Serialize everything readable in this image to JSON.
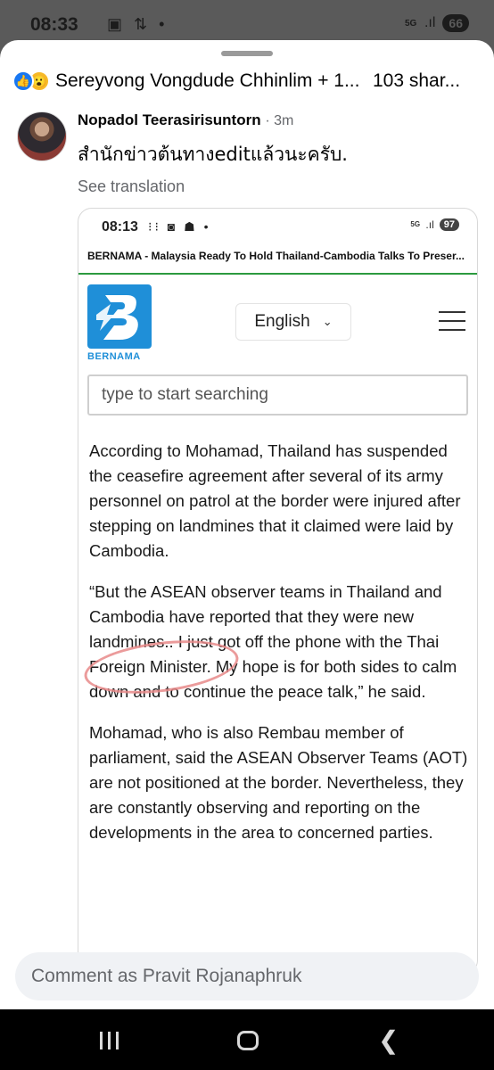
{
  "status_bar": {
    "time": "08:33",
    "network": "5G",
    "battery": "66"
  },
  "reactions": {
    "names": "Sereyvong Vongdude Chhinlim + 1...",
    "shares": "103 shar..."
  },
  "comment": {
    "author": "Nopadol Teerasirisuntorn",
    "time": "· 3m",
    "text": "สำนักข่าวต้นทางeditแล้วนะครับ.",
    "see_translation": "See translation"
  },
  "embedded_screenshot": {
    "status": {
      "time": "08:13",
      "network": "5G",
      "battery": "97"
    },
    "page_title": "BERNAMA - Malaysia Ready To Hold Thailand-Cambodia Talks To Preser...",
    "logo_text": "BERNAMA",
    "language": "English",
    "search_placeholder": "type to start searching",
    "paragraphs": [
      "According to Mohamad, Thailand has suspended the ceasefire agreement after several of its army personnel on patrol at the border were injured after stepping on landmines that it claimed were laid by Cambodia.",
      "“But the ASEAN observer teams in Thailand and Cambodia have reported that they were new landmines.. I just got off the phone with the Thai Foreign Minister. My hope is for both sides to calm down and to continue the peace talk,” he said.",
      "Mohamad, who is also Rembau member of parliament, said the ASEAN Observer Teams (AOT) are not positioned at the border. Nevertheless, they are constantly observing and reporting on the developments in the area to concerned parties."
    ]
  },
  "composer": {
    "placeholder": "Comment as Pravit Rojanaphruk"
  },
  "colors": {
    "accent": "#1877f2",
    "bernama_blue": "#1f8fd8",
    "highlight_circle": "#e88a8a"
  }
}
